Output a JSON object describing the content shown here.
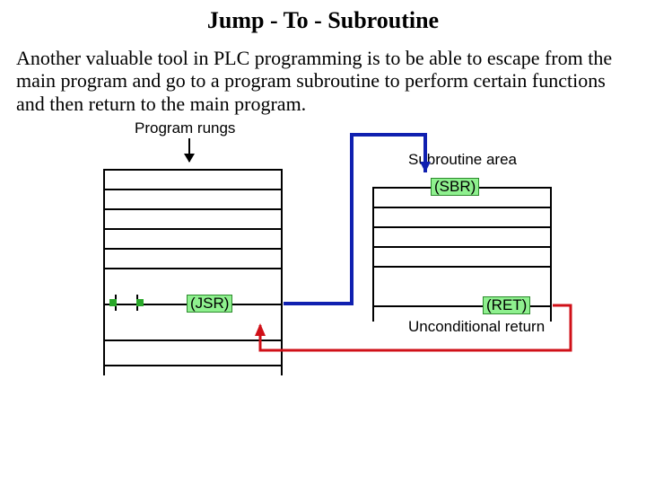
{
  "title": "Jump - To - Subroutine",
  "paragraph": "Another valuable tool in PLC programming is to be able to escape from the main program and go to a program subroutine to perform certain functions and then return to the main program.",
  "labels": {
    "program_rungs": "Program rungs",
    "subroutine_area": "Subroutine area",
    "sbr": "(SBR)",
    "jsr": "(JSR)",
    "ret": "(RET)",
    "unconditional_return": "Unconditional return"
  }
}
